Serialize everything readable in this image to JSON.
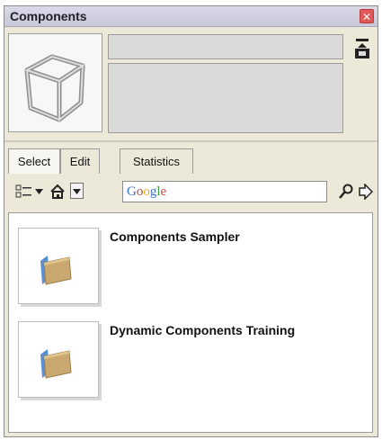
{
  "window": {
    "title": "Components"
  },
  "tabs": [
    {
      "label": "Select"
    },
    {
      "label": "Edit"
    },
    {
      "label": "Statistics"
    }
  ],
  "search": {
    "placeholder": "Google"
  },
  "components": [
    {
      "label": "Components Sampler"
    },
    {
      "label": "Dynamic Components Training"
    }
  ],
  "icons": {
    "close": "close-icon",
    "load": "load-icon",
    "view_options": "view-options-icon",
    "home": "home-icon",
    "dropdown": "chevron-down-icon",
    "search": "magnifier-icon",
    "next": "arrow-right-icon"
  },
  "colors": {
    "window_bg": "#ece9d8",
    "titlebar": "#d9d9e8",
    "close": "#e05858"
  }
}
